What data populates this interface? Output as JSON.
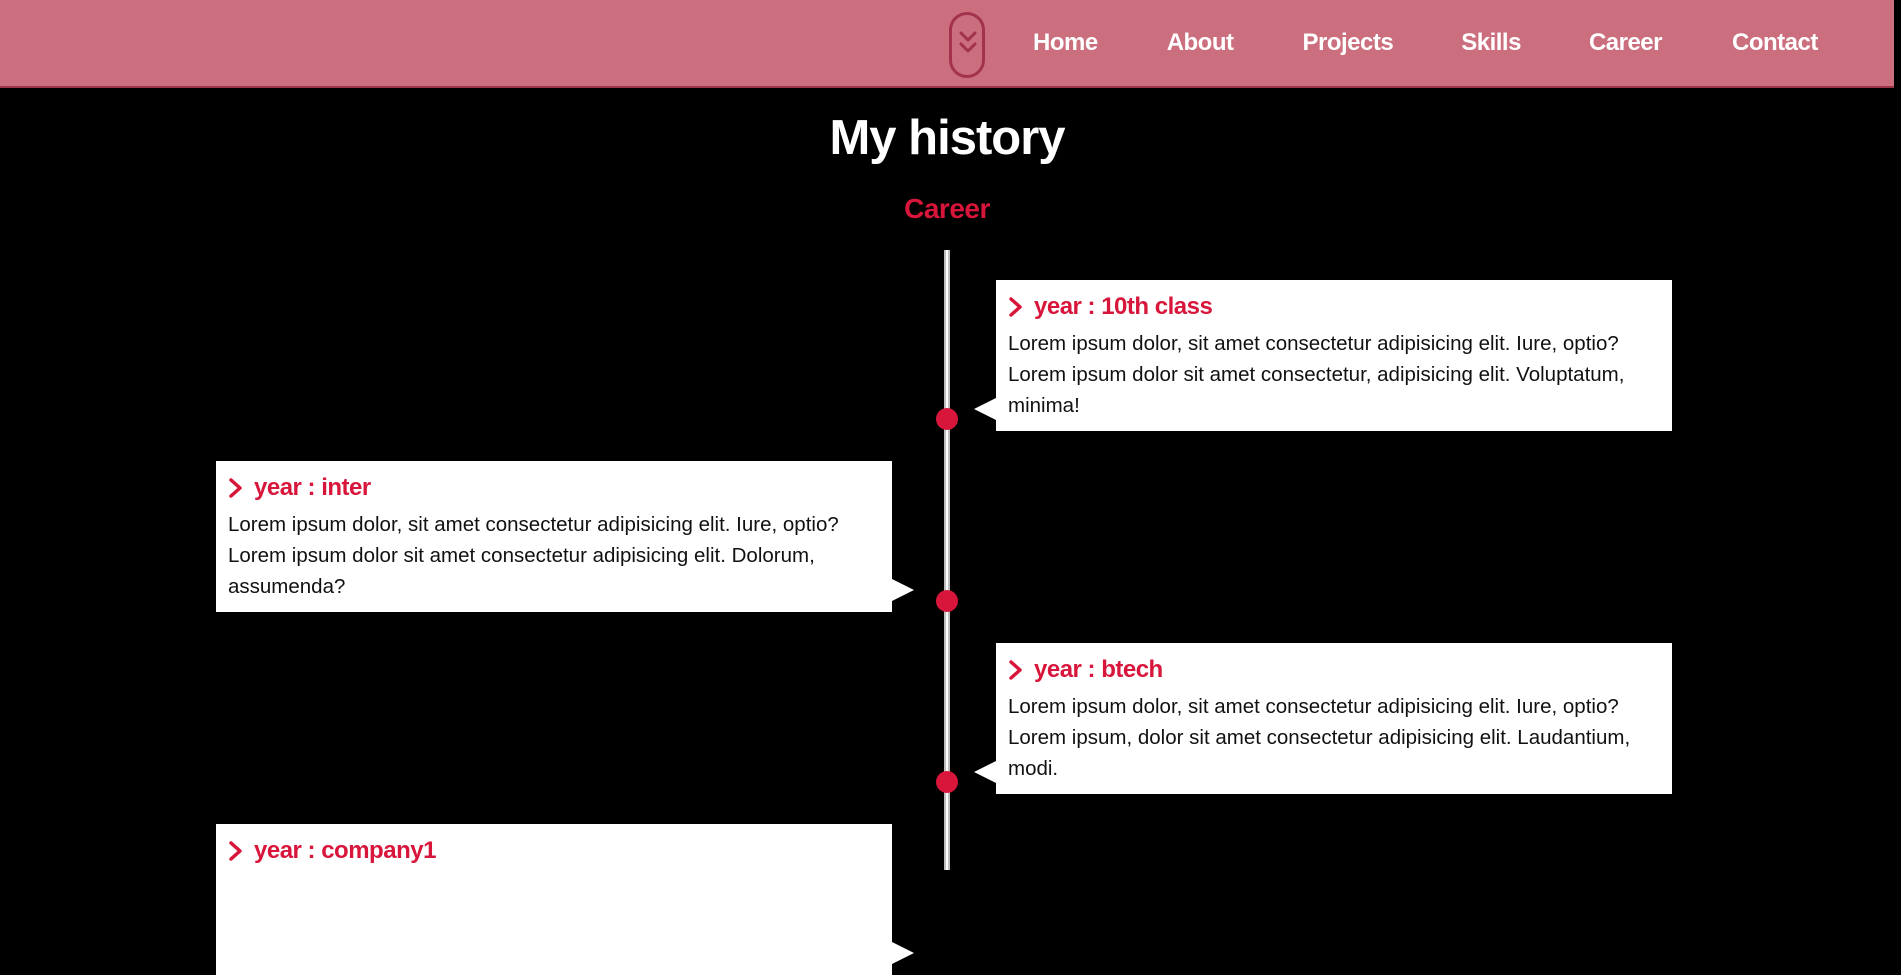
{
  "nav": {
    "links": [
      "Home",
      "About",
      "Projects",
      "Skills",
      "Career",
      "Contact"
    ]
  },
  "header": {
    "title": "My history",
    "subtitle": "Career"
  },
  "timeline": [
    {
      "title": "year : 10th class",
      "text": "Lorem ipsum dolor, sit amet consectetur adipisicing elit. Iure, optio? Lorem ipsum dolor sit amet consectetur, adipisicing elit. Voluptatum, minima!"
    },
    {
      "title": "year : inter",
      "text": "Lorem ipsum dolor, sit amet consectetur adipisicing elit. Iure, optio? Lorem ipsum dolor sit amet consectetur adipisicing elit. Dolorum, assumenda?"
    },
    {
      "title": "year : btech",
      "text": "Lorem ipsum dolor, sit amet consectetur adipisicing elit. Iure, optio? Lorem ipsum, dolor sit amet consectetur adipisicing elit. Laudantium, modi."
    },
    {
      "title": "year : company1",
      "text": ""
    }
  ],
  "colors": {
    "navbar": "#cb6e7e",
    "accent": "#d8163b",
    "background": "#000000",
    "card": "#ffffff"
  },
  "icons": {
    "menu_toggle": "double-chevron-down-icon",
    "item_marker": "chevron-right-icon"
  }
}
